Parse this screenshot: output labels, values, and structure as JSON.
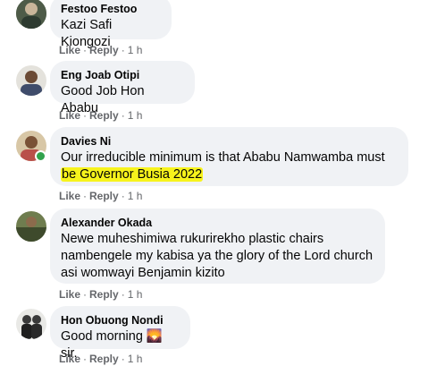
{
  "comments": [
    {
      "author": "Festoo Festoo",
      "text": "Kazi Safi Kiongozi",
      "actions": {
        "like": "Like",
        "reply": "Reply",
        "sep": "·",
        "time": "1 h"
      }
    },
    {
      "author": "Eng Joab Otipi",
      "text": "Good Job Hon Ababu",
      "actions": {
        "like": "Like",
        "reply": "Reply",
        "sep": "·",
        "time": "1 h"
      }
    },
    {
      "author": "Davies Ni",
      "text_line1": "Our irreducible minimum is that Ababu Namwamba must",
      "text_line2": "be Governor Busia 2022",
      "online": true,
      "highlight_color": "#f7f31c",
      "actions": {
        "like": "Like",
        "reply": "Reply",
        "sep": "·",
        "time": "1 h"
      }
    },
    {
      "author": "Alexander Okada",
      "text_line1": "Newe muheshimiwa rukurirekho plastic chairs",
      "text_line2": "nambengele my kabisa ya the glory of the Lord church",
      "text_line3": "asi womwayi Benjamin kizito",
      "actions": {
        "like": "Like",
        "reply": "Reply",
        "sep": "·",
        "time": "1 h"
      }
    },
    {
      "author": "Hon Obuong Nondi",
      "text_before": "Good morning",
      "emoji": "🌄",
      "text_after": "sir.",
      "actions": {
        "like": "Like",
        "reply": "Reply",
        "sep": "·",
        "time": "1 h"
      }
    }
  ],
  "colors": {
    "bubble": "#f0f2f5",
    "text": "#050505",
    "meta": "#65676b",
    "online": "#31a24c"
  }
}
